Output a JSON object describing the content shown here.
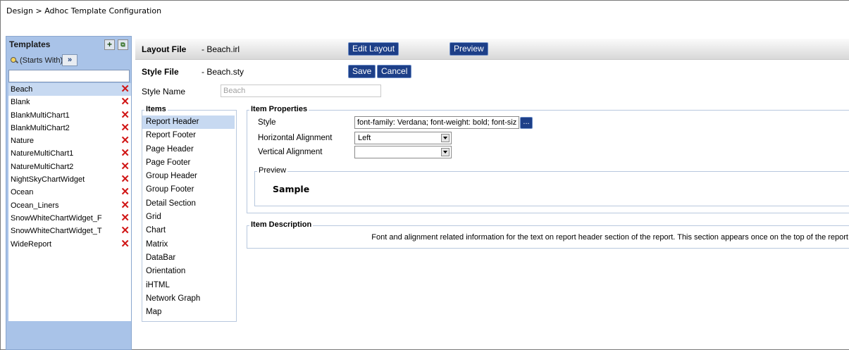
{
  "breadcrumb": "Design > Adhoc Template Configuration",
  "templates": {
    "title": "Templates",
    "filter_label": "(Starts With)",
    "go_label": "»",
    "search_value": "",
    "items": [
      {
        "label": "Beach",
        "selected": true
      },
      {
        "label": "Blank"
      },
      {
        "label": "BlankMultiChart1"
      },
      {
        "label": "BlankMultiChart2"
      },
      {
        "label": "Nature"
      },
      {
        "label": "NatureMultiChart1"
      },
      {
        "label": "NatureMultiChart2"
      },
      {
        "label": "NightSkyChartWidget"
      },
      {
        "label": "Ocean"
      },
      {
        "label": "Ocean_Liners"
      },
      {
        "label": "SnowWhiteChartWidget_F"
      },
      {
        "label": "SnowWhiteChartWidget_T"
      },
      {
        "label": "WideReport"
      }
    ]
  },
  "layout": {
    "label": "Layout File",
    "value": "-  Beach.irl",
    "edit_button": "Edit Layout",
    "preview_button": "Preview"
  },
  "style": {
    "label": "Style File",
    "value": "-  Beach.sty",
    "save_button": "Save",
    "cancel_button": "Cancel",
    "name_label": "Style Name",
    "name_value": "Beach"
  },
  "items_panel": {
    "legend": "Items",
    "items": [
      "Report Header",
      "Report Footer",
      "Page Header",
      "Page Footer",
      "Group Header",
      "Group Footer",
      "Detail Section",
      "Grid",
      "Chart",
      "Matrix",
      "DataBar",
      "Orientation",
      "iHTML",
      "Network Graph",
      "Map"
    ]
  },
  "properties": {
    "legend": "Item Properties",
    "style_label": "Style",
    "style_value": "font-family: Verdana; font-weight: bold; font-siz",
    "ellipsis": "...",
    "halign_label": "Horizontal Alignment",
    "halign_value": "Left",
    "valign_label": "Vertical Alignment",
    "valign_value": "",
    "preview_legend": "Preview",
    "preview_sample": "Sample"
  },
  "description": {
    "legend": "Item Description",
    "text": "Font and alignment related information for the text on report header section of the report. This section appears once on the top of the report"
  }
}
